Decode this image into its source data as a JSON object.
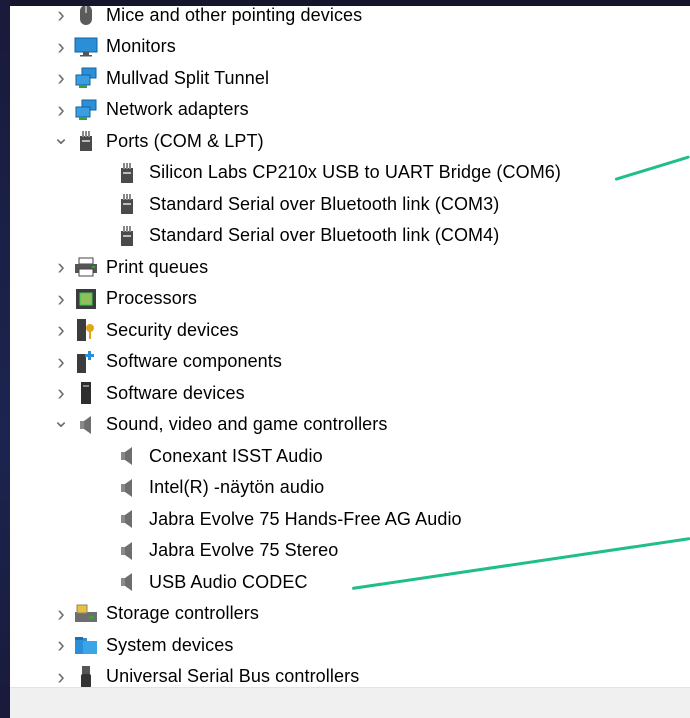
{
  "tree": {
    "categories": [
      {
        "label": "Mice and other pointing devices",
        "expanded": false,
        "icon": "mouse-icon"
      },
      {
        "label": "Monitors",
        "expanded": false,
        "icon": "monitor-icon"
      },
      {
        "label": "Mullvad Split Tunnel",
        "expanded": false,
        "icon": "network-icon"
      },
      {
        "label": "Network adapters",
        "expanded": false,
        "icon": "network-icon"
      },
      {
        "label": "Ports (COM & LPT)",
        "expanded": true,
        "icon": "port-icon",
        "children": [
          "Silicon Labs CP210x USB to UART Bridge (COM6)",
          "Standard Serial over Bluetooth link (COM3)",
          "Standard Serial over Bluetooth link (COM4)"
        ]
      },
      {
        "label": "Print queues",
        "expanded": false,
        "icon": "printer-icon"
      },
      {
        "label": "Processors",
        "expanded": false,
        "icon": "processor-icon"
      },
      {
        "label": "Security devices",
        "expanded": false,
        "icon": "security-key-icon"
      },
      {
        "label": "Software components",
        "expanded": false,
        "icon": "software-component-icon"
      },
      {
        "label": "Software devices",
        "expanded": false,
        "icon": "software-device-icon"
      },
      {
        "label": "Sound, video and game controllers",
        "expanded": true,
        "icon": "speaker-icon",
        "children": [
          "Conexant ISST Audio",
          "Intel(R) -näytön audio",
          "Jabra Evolve 75 Hands-Free AG Audio",
          "Jabra Evolve 75 Stereo",
          "USB Audio CODEC"
        ]
      },
      {
        "label": "Storage controllers",
        "expanded": false,
        "icon": "storage-icon"
      },
      {
        "label": "System devices",
        "expanded": false,
        "icon": "system-folder-icon"
      },
      {
        "label": "Universal Serial Bus controllers",
        "expanded": false,
        "icon": "usb-icon"
      }
    ]
  },
  "colors": {
    "annotation_line": "#1fbf86",
    "monitor_blue": "#2a8fd6",
    "network_green": "#3aa03a"
  }
}
